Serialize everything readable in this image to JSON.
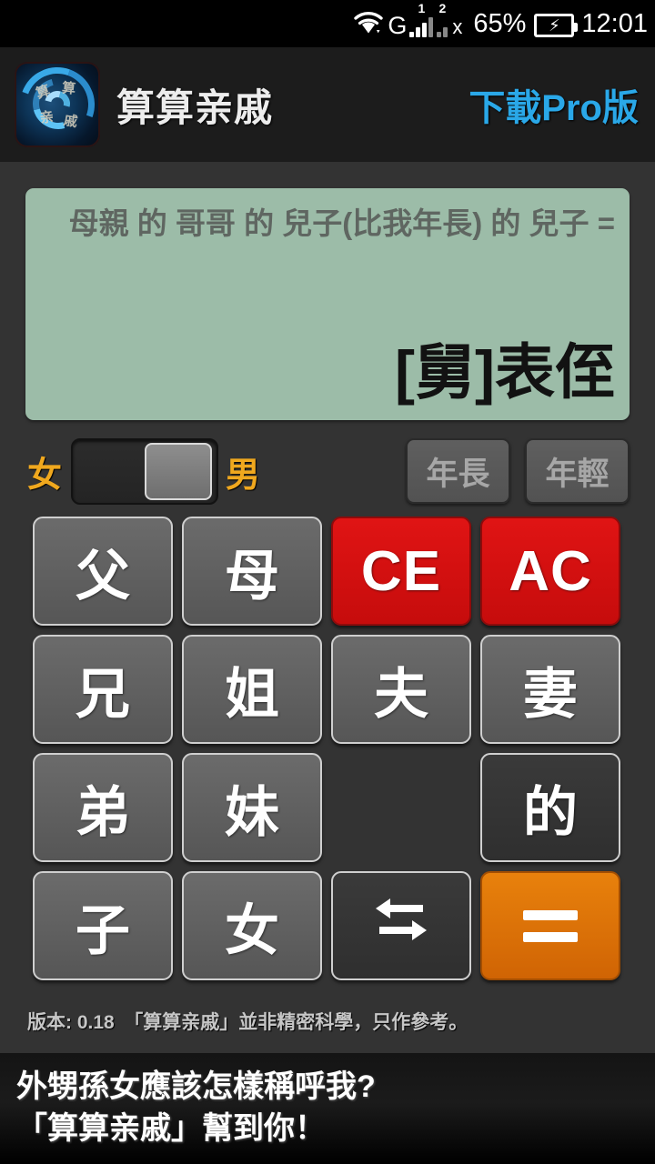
{
  "status_bar": {
    "wifi_icon": "wifi-icon",
    "network_type": "G",
    "sim1_label": "1",
    "sim2_label": "2",
    "sim2_state": "x",
    "battery_percent": "65%",
    "battery_icon": "battery-charging-icon",
    "time": "12:01"
  },
  "title_bar": {
    "app_icon": "app-icon",
    "app_title": "算算亲戚",
    "pro_link": "下載Pro版",
    "pro_link_color": "#2aa8e8"
  },
  "display": {
    "expression": "母親 的 哥哥 的 兒子(比我年長) 的 兒子 =",
    "result": "[舅]表侄",
    "background_color": "#9cbca8"
  },
  "controls": {
    "female_label": "女",
    "male_label": "男",
    "label_color": "#f0a81e",
    "switch_position": "right",
    "age_elder": "年長",
    "age_younger": "年輕"
  },
  "keypad": {
    "keys": [
      {
        "label": "父",
        "name": "key-father",
        "style": "grey"
      },
      {
        "label": "母",
        "name": "key-mother",
        "style": "grey"
      },
      {
        "label": "CE",
        "name": "key-clear-entry",
        "style": "red"
      },
      {
        "label": "AC",
        "name": "key-all-clear",
        "style": "red"
      },
      {
        "label": "兄",
        "name": "key-elder-brother",
        "style": "grey"
      },
      {
        "label": "姐",
        "name": "key-elder-sister",
        "style": "grey"
      },
      {
        "label": "夫",
        "name": "key-husband",
        "style": "grey"
      },
      {
        "label": "妻",
        "name": "key-wife",
        "style": "grey"
      },
      {
        "label": "弟",
        "name": "key-younger-brother",
        "style": "grey"
      },
      {
        "label": "妹",
        "name": "key-younger-sister",
        "style": "grey"
      },
      {
        "label": "",
        "name": "key-blank",
        "style": "blank"
      },
      {
        "label": "的",
        "name": "key-possessive",
        "style": "dark"
      },
      {
        "label": "子",
        "name": "key-son",
        "style": "grey"
      },
      {
        "label": "女",
        "name": "key-daughter",
        "style": "grey"
      },
      {
        "label": "",
        "name": "key-swap",
        "style": "dark",
        "icon": "swap-arrows-icon"
      },
      {
        "label": "",
        "name": "key-equals",
        "style": "orange",
        "icon": "equals-icon"
      }
    ],
    "red_color": "#d61010",
    "orange_color": "#dd6b00"
  },
  "footer": {
    "note": "版本: 0.18　「算算亲戚」並非精密科學，只作參考。"
  },
  "banner": {
    "line1": "外甥孫女應該怎樣稱呼我?",
    "line2": "「算算亲戚」幫到你！"
  }
}
